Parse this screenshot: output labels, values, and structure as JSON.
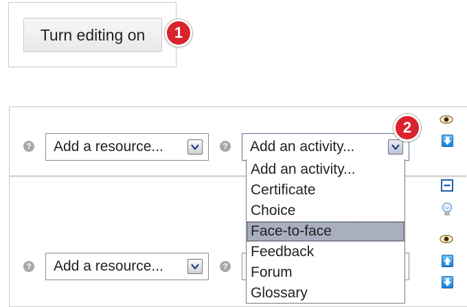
{
  "editing": {
    "turn_editing_label": "Turn editing on",
    "badge_1": "1",
    "badge_2": "2"
  },
  "section1": {
    "resource_select": "Add a resource...",
    "activity_select": "Add an activity...",
    "help_glyph": "?"
  },
  "section2": {
    "resource_select": "Add a resource...",
    "help_glyph": "?"
  },
  "activity_dropdown": {
    "options": [
      "Add an activity...",
      "Certificate",
      "Choice",
      "Face-to-face",
      "Feedback",
      "Forum",
      "Glossary"
    ],
    "highlighted": "Face-to-face"
  },
  "icons": {
    "section1": [
      "eye-icon",
      "move-down-icon"
    ],
    "section2": [
      "collapse-icon",
      "highlight-bulb-icon",
      "eye-icon",
      "move-up-icon",
      "move-down-icon"
    ]
  },
  "colors": {
    "badge": "#d9232d",
    "highlight": "#a9afbf",
    "arrow_blue": "#1a7fd6"
  }
}
